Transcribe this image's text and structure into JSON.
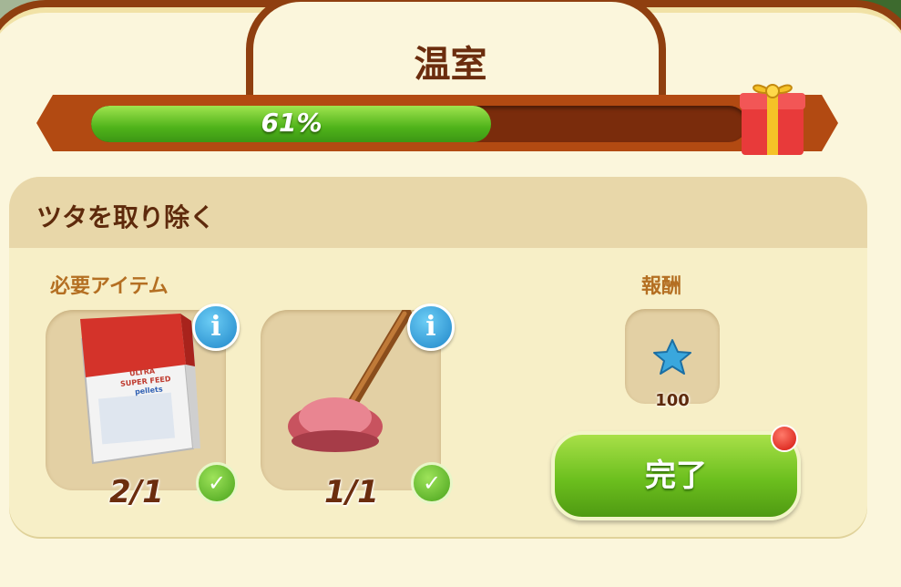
{
  "panel": {
    "title": "温室",
    "progress": {
      "percent_value": 61,
      "label": "61%"
    }
  },
  "task": {
    "name": "ツタを取り除く",
    "required_label": "必要アイテム",
    "reward_label": "報酬",
    "items": [
      {
        "name": "plant-food-box",
        "count": "2/1",
        "packaging_text": [
          "ULTRA",
          "SUPER FEED",
          "pellets"
        ]
      },
      {
        "name": "plunger",
        "count": "1/1"
      }
    ],
    "reward": {
      "icon": "blue-star-icon",
      "amount": "100"
    },
    "complete_label": "完了"
  },
  "colors": {
    "frame": "#8f3f10",
    "panel_bg": "#fbf6dc",
    "progress_green": "#4fb31a",
    "title_text": "#6b2d0e",
    "button_green": "#6cbf1e",
    "info_blue": "#1f86c9"
  }
}
